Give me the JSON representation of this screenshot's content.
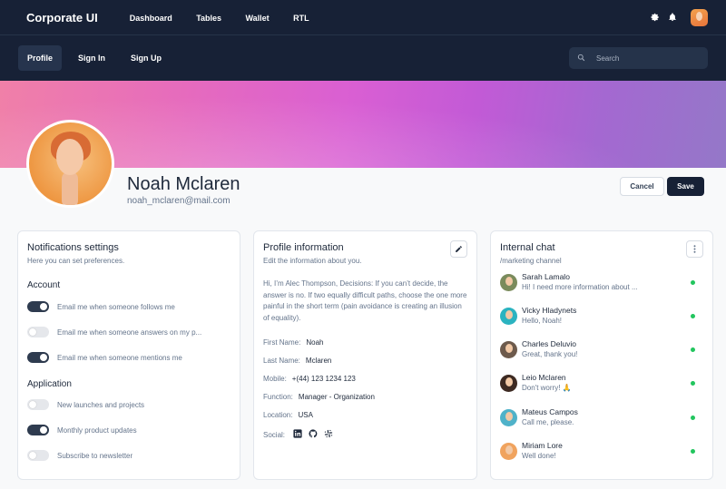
{
  "brand": "Corporate UI",
  "topnav": [
    "Dashboard",
    "Tables",
    "Wallet",
    "RTL"
  ],
  "tabs": [
    "Profile",
    "Sign In",
    "Sign Up"
  ],
  "search": {
    "placeholder": "Search"
  },
  "profile": {
    "name": "Noah Mclaren",
    "email": "noah_mclaren@mail.com"
  },
  "actions": {
    "cancel": "Cancel",
    "save": "Save"
  },
  "notifications": {
    "title": "Notifications settings",
    "subtitle": "Here you can set preferences.",
    "account_heading": "Account",
    "account": [
      {
        "label": "Email me when someone follows me",
        "on": true
      },
      {
        "label": "Email me when someone answers on my p...",
        "on": false
      },
      {
        "label": "Email me when someone mentions me",
        "on": true
      }
    ],
    "application_heading": "Application",
    "application": [
      {
        "label": "New launches and projects",
        "on": false
      },
      {
        "label": "Monthly product updates",
        "on": true
      },
      {
        "label": "Subscribe to newsletter",
        "on": false
      }
    ]
  },
  "profile_info": {
    "title": "Profile information",
    "subtitle": "Edit the information about you.",
    "bio": "Hi, I’m Alec Thompson, Decisions: If you can’t decide, the answer is no. If two equally difficult paths, choose the one more painful in the short term (pain avoidance is creating an illusion of equality).",
    "fields": [
      {
        "label": "First Name:",
        "value": "Noah"
      },
      {
        "label": "Last Name:",
        "value": "Mclaren"
      },
      {
        "label": "Mobile:",
        "value": "+(44) 123 1234 123"
      },
      {
        "label": "Function:",
        "value": "Manager - Organization"
      },
      {
        "label": "Location:",
        "value": "USA"
      }
    ],
    "social_label": "Social:",
    "social_icons": [
      "linkedin-icon",
      "github-icon",
      "slack-icon"
    ]
  },
  "chat": {
    "title": "Internal chat",
    "subtitle": "/marketing channel",
    "online_color": "#22c55e",
    "items": [
      {
        "name": "Sarah Lamalo",
        "message": "Hi! I need more information about ...",
        "avatar_color": "#7a8b5c"
      },
      {
        "name": "Vicky Hladynets",
        "message": "Hello, Noah!",
        "avatar_color": "#2bb3c0"
      },
      {
        "name": "Charles Deluvio",
        "message": "Great, thank you!",
        "avatar_color": "#6d5a4c"
      },
      {
        "name": "Leio Mclaren",
        "message": "Don't worry! 🙏",
        "avatar_color": "#3d2a22"
      },
      {
        "name": "Mateus Campos",
        "message": "Call me, please.",
        "avatar_color": "#4fb2c9"
      },
      {
        "name": "Miriam Lore",
        "message": "Well done!",
        "avatar_color": "#f0a35e"
      }
    ]
  }
}
